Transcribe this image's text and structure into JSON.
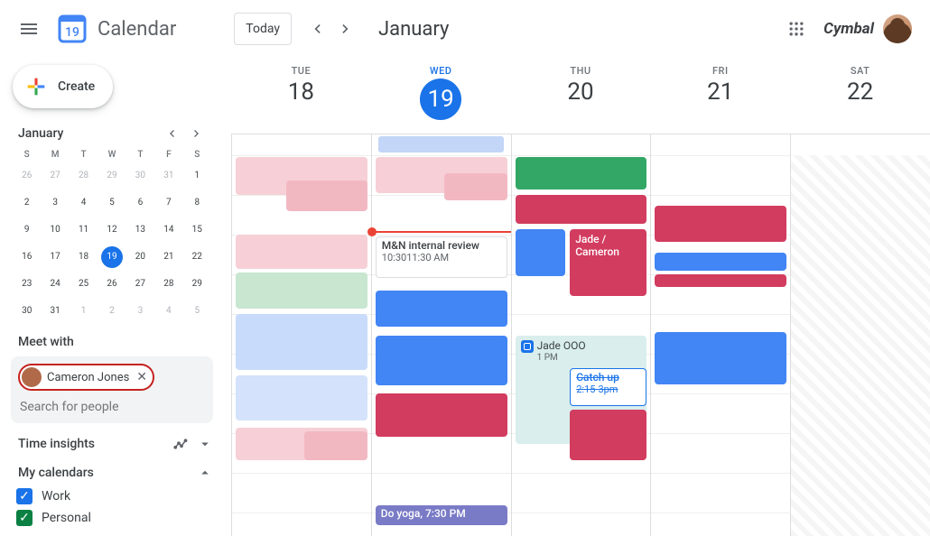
{
  "header": {
    "appTitle": "Calendar",
    "todayLabel": "Today",
    "monthTitle": "January",
    "brand": "Cymbal",
    "logoDay": "19"
  },
  "sidebar": {
    "createLabel": "Create",
    "miniMonthTitle": "January",
    "dows": [
      "S",
      "M",
      "T",
      "W",
      "T",
      "F",
      "S"
    ],
    "miniDays": [
      {
        "n": "26",
        "o": true
      },
      {
        "n": "27",
        "o": true
      },
      {
        "n": "28",
        "o": true
      },
      {
        "n": "29",
        "o": true
      },
      {
        "n": "30",
        "o": true
      },
      {
        "n": "31",
        "o": true
      },
      {
        "n": "1"
      },
      {
        "n": "2"
      },
      {
        "n": "3"
      },
      {
        "n": "4"
      },
      {
        "n": "5"
      },
      {
        "n": "6"
      },
      {
        "n": "7"
      },
      {
        "n": "8"
      },
      {
        "n": "9"
      },
      {
        "n": "10"
      },
      {
        "n": "11"
      },
      {
        "n": "12"
      },
      {
        "n": "13"
      },
      {
        "n": "14"
      },
      {
        "n": "15"
      },
      {
        "n": "16"
      },
      {
        "n": "17"
      },
      {
        "n": "18"
      },
      {
        "n": "19",
        "t": true
      },
      {
        "n": "20"
      },
      {
        "n": "21"
      },
      {
        "n": "22"
      },
      {
        "n": "23"
      },
      {
        "n": "24"
      },
      {
        "n": "25"
      },
      {
        "n": "26"
      },
      {
        "n": "27"
      },
      {
        "n": "28"
      },
      {
        "n": "29"
      },
      {
        "n": "30"
      },
      {
        "n": "31"
      },
      {
        "n": "1",
        "o": true
      },
      {
        "n": "2",
        "o": true
      },
      {
        "n": "3",
        "o": true
      },
      {
        "n": "4",
        "o": true
      },
      {
        "n": "5",
        "o": true
      }
    ],
    "meetWithTitle": "Meet with",
    "chipName": "Cameron Jones",
    "searchPlaceholder": "Search for people",
    "timeInsightsTitle": "Time insights",
    "myCalendarsTitle": "My calendars",
    "calWork": "Work",
    "calPersonal": "Personal"
  },
  "days": [
    {
      "dow": "TUE",
      "num": "18",
      "today": false
    },
    {
      "dow": "WED",
      "num": "19",
      "today": true
    },
    {
      "dow": "THU",
      "num": "20",
      "today": false
    },
    {
      "dow": "FRI",
      "num": "21",
      "today": false
    },
    {
      "dow": "SAT",
      "num": "22",
      "today": false
    }
  ],
  "events": {
    "mn_review_title": "M&N internal review",
    "mn_review_time": "10:3011:30 AM",
    "jade_cameron": "Jade / Cameron",
    "jade_ooo_title": "Jade OOO",
    "jade_ooo_time": "1 PM",
    "catchup_title": "Catch up",
    "catchup_time": "2:15-3pm",
    "yoga": "Do yoga, 7:30 PM"
  }
}
